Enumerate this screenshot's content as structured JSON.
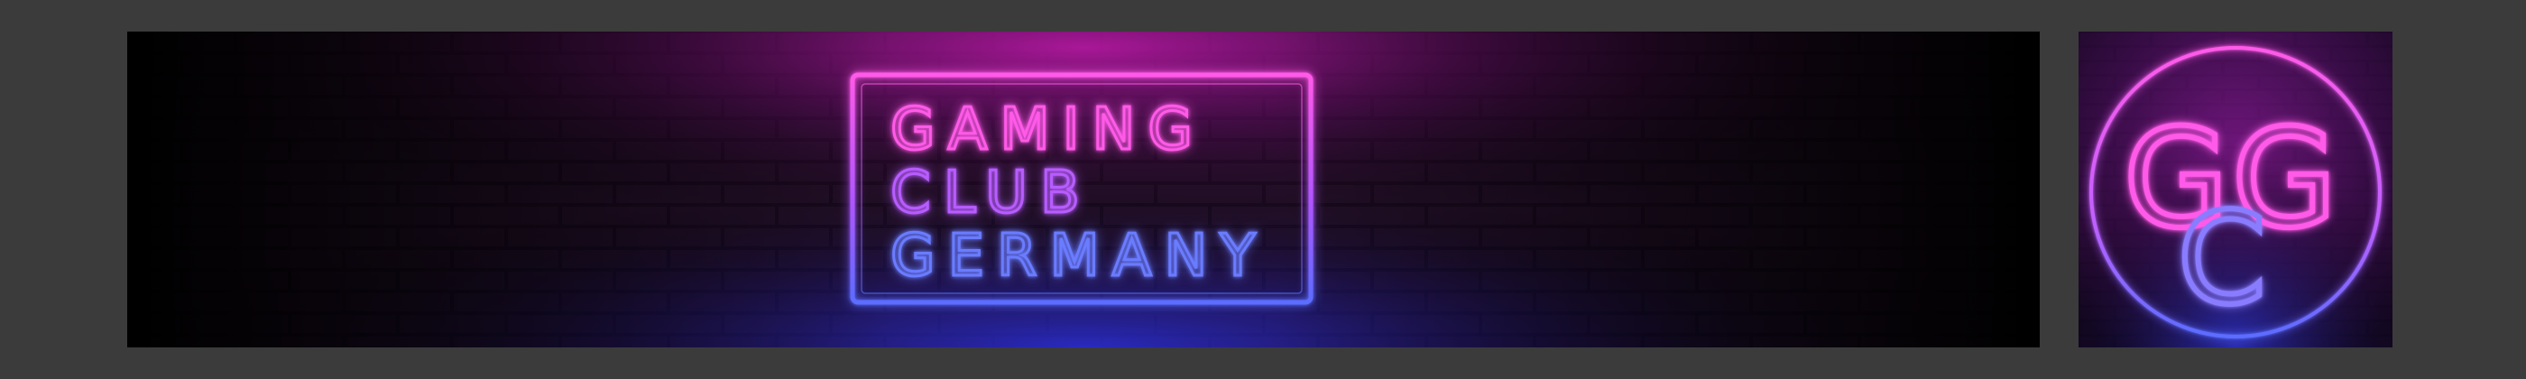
{
  "banner": {
    "lines": [
      "GAMING",
      "CLUB",
      "GERMANY"
    ]
  },
  "avatar": {
    "monogram": [
      "G",
      "G",
      "C"
    ]
  },
  "colors": {
    "background": "#3b3b3b",
    "neon_pink": "#ff4fe6",
    "neon_magenta": "#c01aa8",
    "neon_blue": "#5a6cff",
    "neon_violet": "#8a3cff",
    "brick_dark": "#160718"
  }
}
